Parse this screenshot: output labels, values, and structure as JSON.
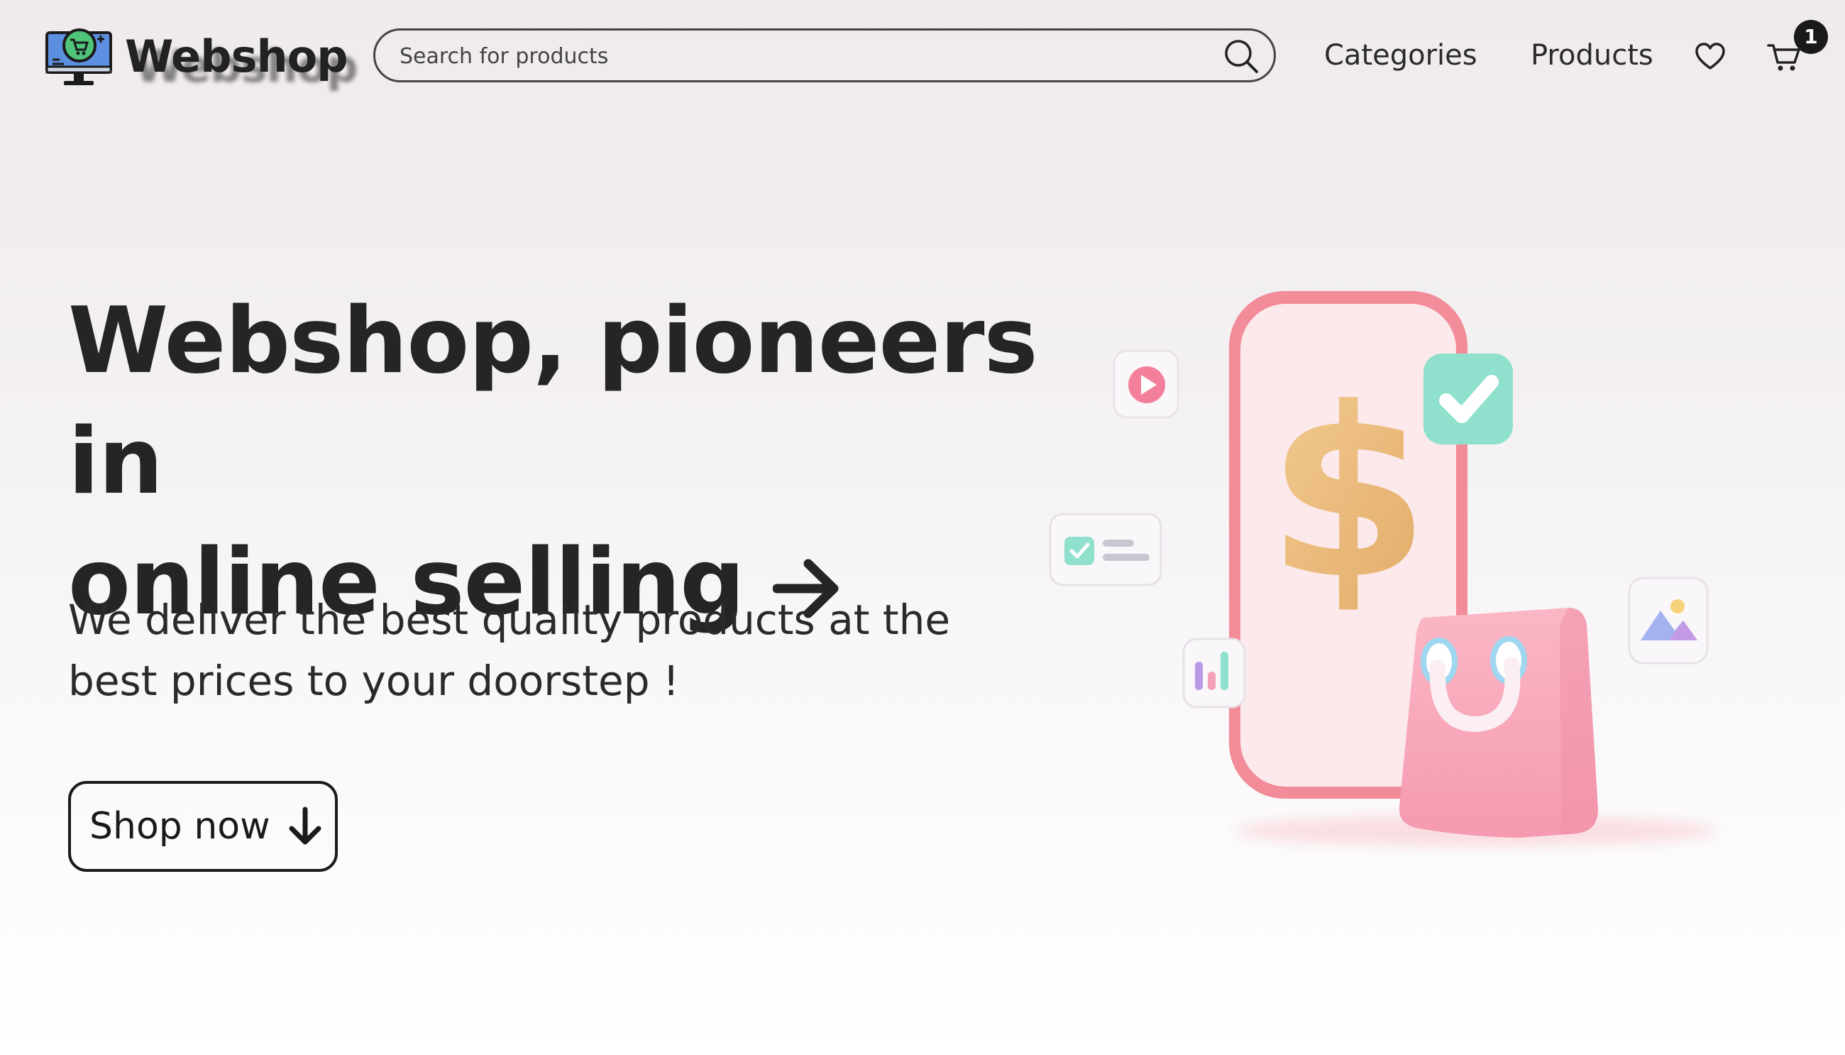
{
  "header": {
    "brand": "Webshop",
    "search_placeholder": "Search for products",
    "nav": {
      "categories": "Categories",
      "products": "Products"
    },
    "cart_count": "1",
    "icons": [
      "monitor-cart-logo-icon",
      "search-icon",
      "heart-icon",
      "cart-icon"
    ]
  },
  "hero": {
    "title_line1": "Webshop, pioneers in",
    "title_line2": "online selling",
    "subtitle_line1": "We deliver the best quality products at the",
    "subtitle_line2": "best prices to your doorstep !",
    "cta_label": "Shop now",
    "icons": [
      "arrow-right-icon",
      "arrow-down-icon"
    ]
  },
  "illustration": {
    "symbol": "$",
    "icons": [
      "phone-icon",
      "dollar-icon",
      "shopping-bag-icon",
      "play-icon",
      "check-icon",
      "list-card-icon",
      "bar-chart-icon",
      "image-icon"
    ]
  },
  "colors": {
    "text": "#222222",
    "phone": "#f18c98",
    "bag": "#f7a6bb",
    "dollar": "#eab979",
    "check": "#8fe0cc"
  }
}
